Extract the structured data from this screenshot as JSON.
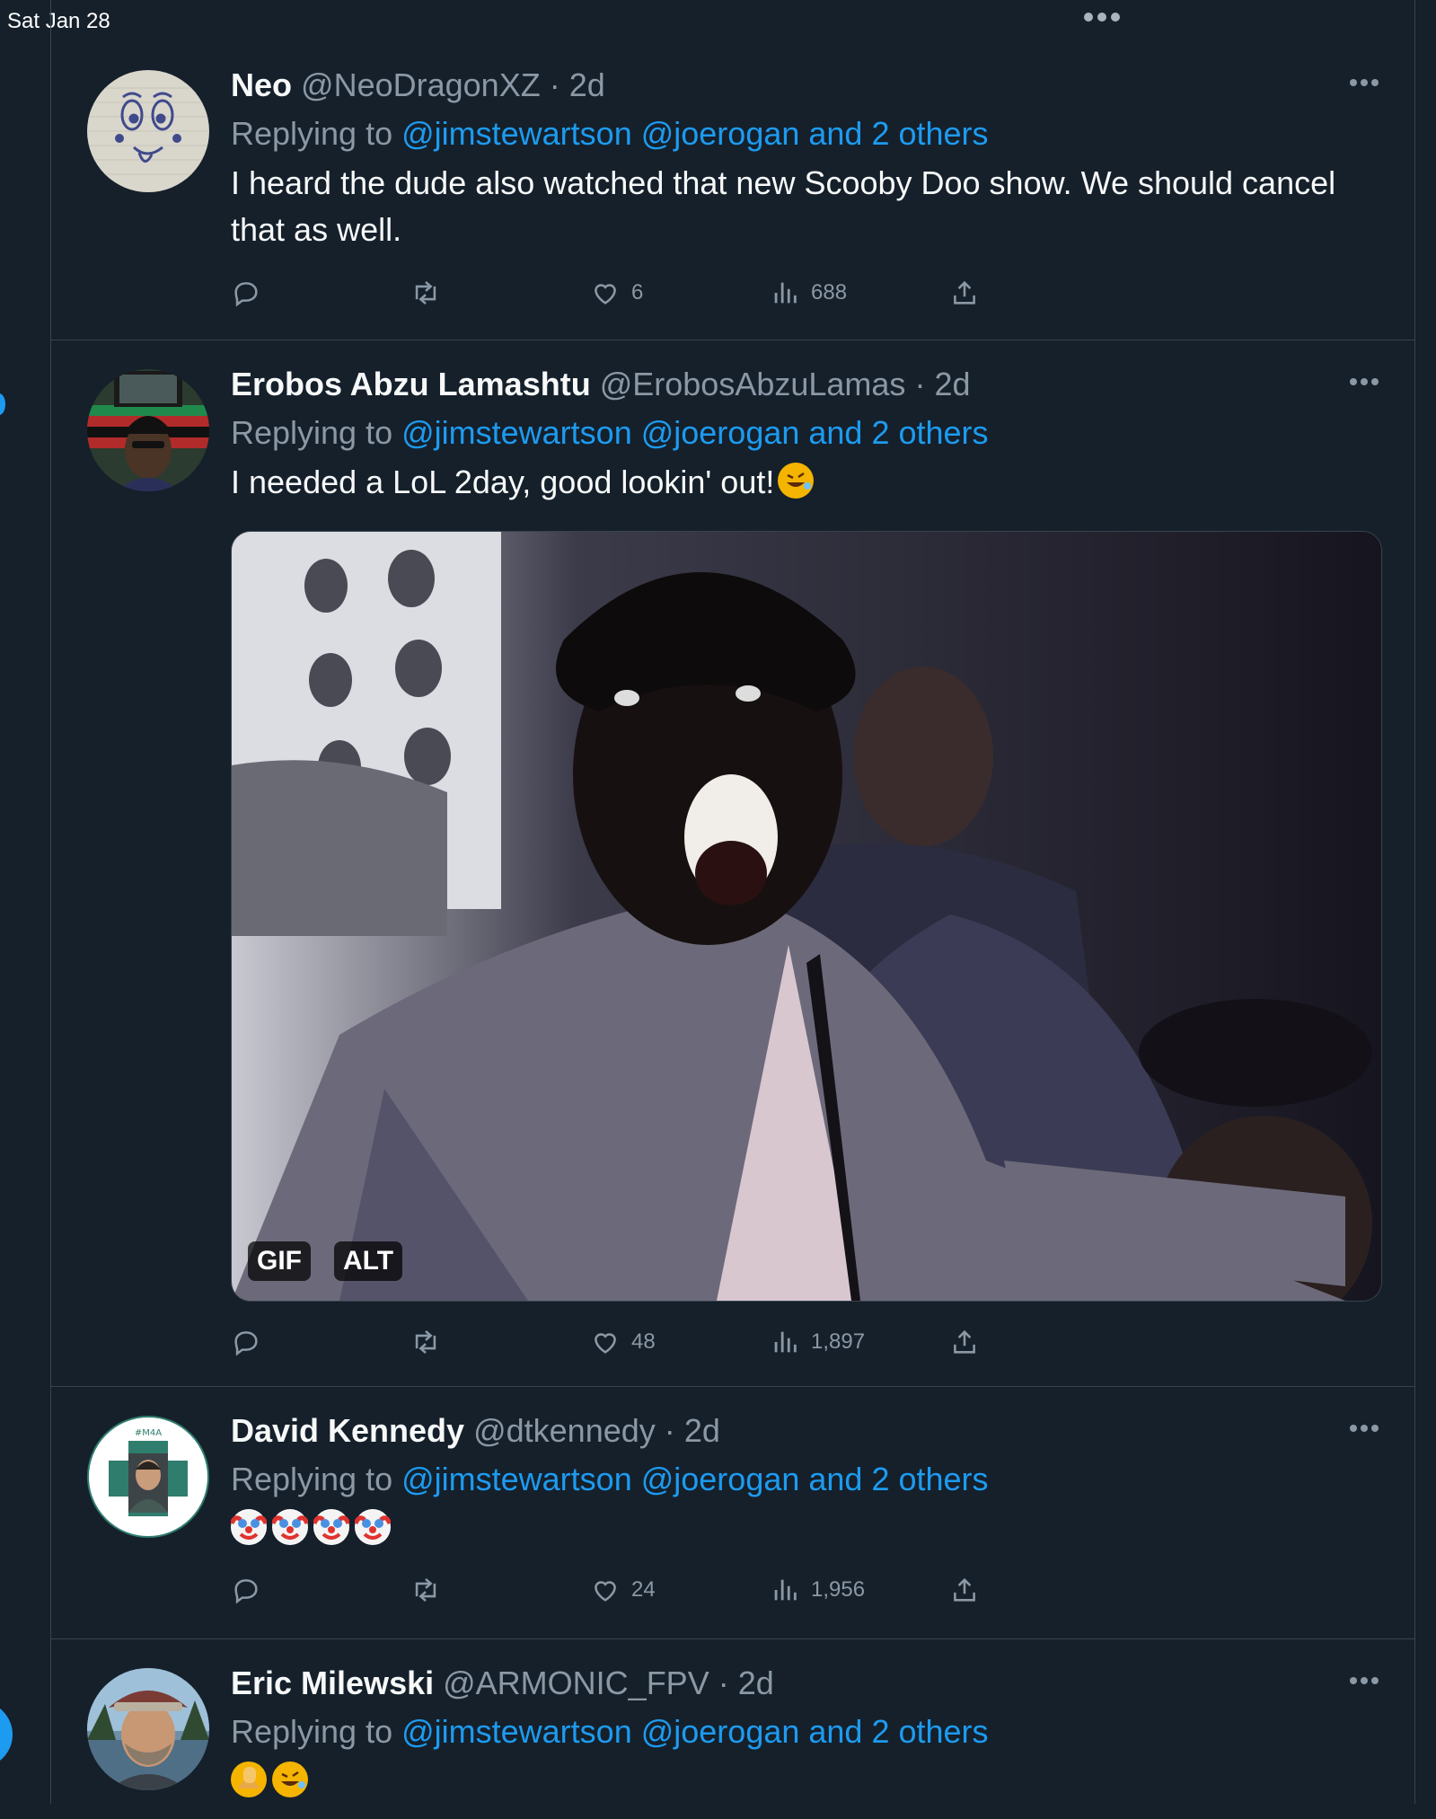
{
  "status_bar": {
    "date": "Sat Jan 28"
  },
  "tweets": [
    {
      "name": "Neo",
      "handle": "@NeoDragonXZ",
      "time": "2d",
      "replying_prefix": "Replying to ",
      "replying_to": "@jimstewartson @joerogan and 2 others",
      "text": "I heard the dude also watched that new Scooby Doo show. We should cancel that as well.",
      "likes": "6",
      "views": "688"
    },
    {
      "name": "Erobos Abzu Lamashtu",
      "handle": "@ErobosAbzuLamas",
      "time": "2d",
      "replying_prefix": "Replying to ",
      "replying_to": "@jimstewartson @joerogan and 2 others",
      "text": "I needed a LoL 2day, good lookin' out!",
      "emoji": [
        "rolling-on-floor-laughing"
      ],
      "media": {
        "badges": [
          "GIF",
          "ALT"
        ]
      },
      "likes": "48",
      "views": "1,897"
    },
    {
      "name": "David Kennedy",
      "handle": "@dtkennedy",
      "time": "2d",
      "replying_prefix": "Replying to ",
      "replying_to": "@jimstewartson @joerogan and 2 others",
      "text": "",
      "emoji": [
        "clown-face",
        "clown-face",
        "clown-face",
        "clown-face"
      ],
      "avatar_label": "#M4A",
      "likes": "24",
      "views": "1,956"
    },
    {
      "name": "Eric Milewski",
      "handle": "@ARMONIC_FPV",
      "time": "2d",
      "replying_prefix": "Replying to ",
      "replying_to": "@jimstewartson @joerogan and 2 others",
      "text": "",
      "emoji": [
        "face-palm",
        "rolling-on-floor-laughing"
      ]
    }
  ],
  "colors": {
    "background": "#15202b",
    "divider": "#38444d",
    "text_primary": "#f7f9f9",
    "text_secondary": "#8b98a5",
    "accent": "#1d9bf0"
  },
  "icons": [
    "reply-icon",
    "retweet-icon",
    "like-icon",
    "views-icon",
    "share-icon",
    "more-icon"
  ]
}
